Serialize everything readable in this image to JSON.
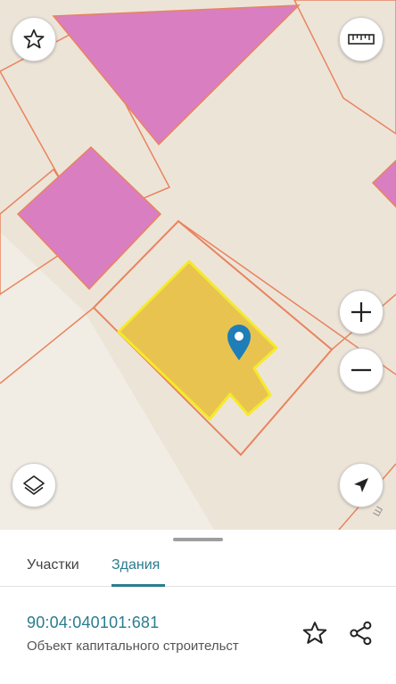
{
  "map": {
    "colors": {
      "background": "#ede4d8",
      "building_pink": "#d97ec0",
      "parcel_outline": "#e8845e",
      "selected_fill": "#e9c34f",
      "selected_outline": "#f5ea2a",
      "marker": "#1f7eb8"
    },
    "street_label_fragment": "ш",
    "controls": {
      "favorite": {
        "icon": "star-outline-icon"
      },
      "ruler": {
        "icon": "ruler-icon"
      },
      "zoom_in": {
        "icon": "plus-icon"
      },
      "zoom_out": {
        "icon": "minus-icon"
      },
      "layers": {
        "icon": "layers-icon"
      },
      "locate": {
        "icon": "navigation-arrow-icon"
      }
    },
    "marker_icon": "location-pin-icon"
  },
  "tabs": [
    {
      "label": "Участки",
      "active": false
    },
    {
      "label": "Здания",
      "active": true
    }
  ],
  "result": {
    "cadastral_number": "90:04:040101:681",
    "object_type": "Объект капитального строительст",
    "actions": {
      "favorite": "star-outline-icon",
      "share": "share-icon"
    }
  }
}
